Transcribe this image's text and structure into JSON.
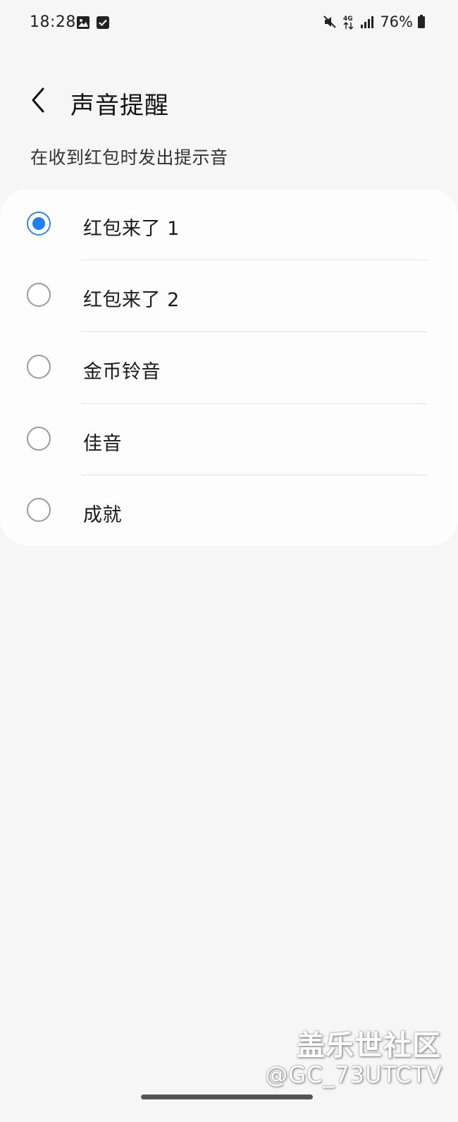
{
  "status_bar": {
    "time": "18:28",
    "left_icons": [
      "image-icon",
      "checkbox-icon"
    ],
    "right_icons": [
      "mute-icon",
      "4g-icon",
      "signal-icon"
    ],
    "battery_text": "76%"
  },
  "header": {
    "back_icon": "chevron-left-icon",
    "title": "声音提醒"
  },
  "subtitle": "在收到红包时发出提示音",
  "options": [
    {
      "label": "红包来了 1",
      "selected": true
    },
    {
      "label": "红包来了 2",
      "selected": false
    },
    {
      "label": "金币铃音",
      "selected": false
    },
    {
      "label": "佳音",
      "selected": false
    },
    {
      "label": "成就",
      "selected": false
    }
  ],
  "colors": {
    "accent": "#1e7ff0",
    "background": "#f6f6f6",
    "card": "#fdfdfd"
  },
  "watermark": {
    "text": "盖乐世社区",
    "handle": "@GC_73UTCTV"
  }
}
